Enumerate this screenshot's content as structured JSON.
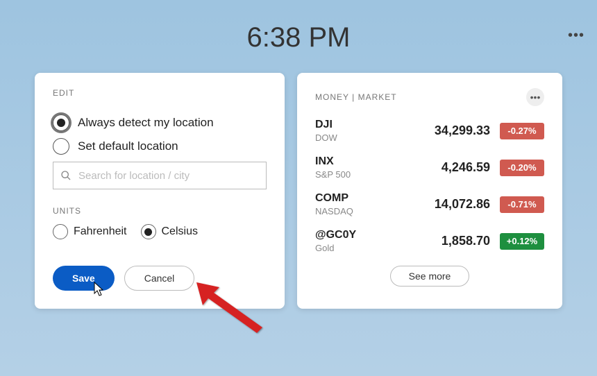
{
  "header": {
    "time": "6:38 PM"
  },
  "edit_card": {
    "heading": "EDIT",
    "location_options": {
      "detect": "Always detect my location",
      "default": "Set default location"
    },
    "search_placeholder": "Search for location / city",
    "units_heading": "UNITS",
    "units": {
      "fahrenheit": "Fahrenheit",
      "celsius": "Celsius"
    },
    "save_label": "Save",
    "cancel_label": "Cancel"
  },
  "money_card": {
    "heading": "MONEY | MARKET",
    "see_more": "See more",
    "tickers": [
      {
        "symbol": "DJI",
        "name": "DOW",
        "price": "34,299.33",
        "change": "-0.27%",
        "dir": "neg"
      },
      {
        "symbol": "INX",
        "name": "S&P 500",
        "price": "4,246.59",
        "change": "-0.20%",
        "dir": "neg"
      },
      {
        "symbol": "COMP",
        "name": "NASDAQ",
        "price": "14,072.86",
        "change": "-0.71%",
        "dir": "neg"
      },
      {
        "symbol": "@GC0Y",
        "name": "Gold",
        "price": "1,858.70",
        "change": "+0.12%",
        "dir": "pos"
      }
    ]
  }
}
